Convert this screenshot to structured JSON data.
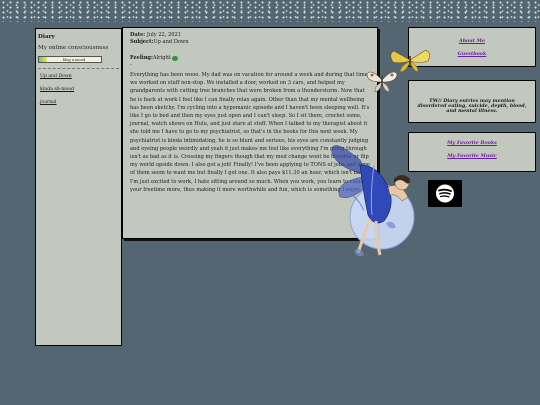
{
  "sidebar": {
    "title": "Diary",
    "subtitle": "My online consciousness",
    "badge": "blog a mood",
    "links": [
      "Up and Down",
      "kinda sh-mood",
      "journal"
    ]
  },
  "entry": {
    "date_label": "Date:",
    "date": "July 22, 2021",
    "subject_label": "Subject:",
    "subject": "Up and Down",
    "feeling_label": "Feeling:",
    "feeling": "Alright",
    "separator": "-",
    "body": "Everything has been wooo. My dad was on vacation for around a week and during that time we worked on stuff non-stop. We installed a door, worked on 3 cars, and helped my grandparents with cutting tree branches that were broken from a thunderstorm. Now that he is back at work I feel like I can finally relax again. Other than that my mental wellbeing has been sketchy. I'm cycling into a hypomanic episode and I haven't been sleeping well. It's like I go to bed and then my eyes just open and I can't sleep. So I sit there, crochet some, journal, watch shows on Hulu, and just stare at stuff. When I talked to my therapist about it she told me I have to go to my psychiatrist, so that's in the books for this next week. My psychiatrist is kinda intimidating, he is so blunt and serious, his eyes are constantly judging and eyeing people weirdly and yeah it just makes me feel like everything I'm going through isn't as bad as it is. Crossing my fingers though that my med change wont be horrible or flip my world upside down. I also got a job! Finally! I've been applying to TONS of jobs and none of them seem to want me but finally I got one. It also pays $11.30 an hour, which isn't bad! I'm just excited to work, I hate sitting around so much. When you work, you learn to value your freetime more, thus making it more worthwhile and fun, which is something I enjoy."
  },
  "right": {
    "about": "About Me",
    "guestbook": "Guestbook",
    "tw": "TW// Diary entries may mention disordered eating, suicide, depth, blood, and mental illness.",
    "books": "My Favorite Books",
    "music": "My Favorite Music"
  },
  "icons": {
    "spotify": "spotify-icon",
    "butterfly": "butterfly-icon",
    "fairy": "fairy-icon",
    "mood": "mood-face-icon"
  },
  "colors": {
    "background": "#536672",
    "panel": "#c3c8bf",
    "link": "#6a1f9a"
  }
}
